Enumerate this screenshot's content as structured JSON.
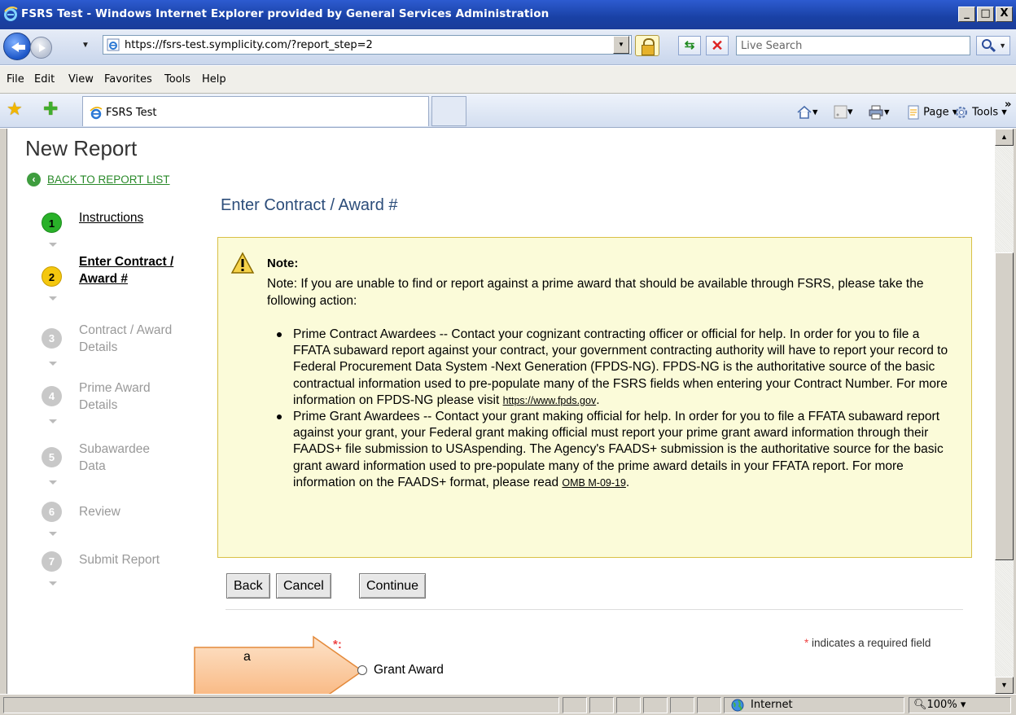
{
  "window": {
    "title": "FSRS Test - Windows Internet Explorer provided by General Services Administration",
    "buttons": [
      "_",
      "□",
      "X"
    ]
  },
  "address": {
    "url": "https://fsrs-test.symplicity.com/?report_step=2",
    "search_placeholder": "Live Search"
  },
  "menu": [
    "File",
    "Edit",
    "View",
    "Favorites",
    "Tools",
    "Help"
  ],
  "tab": {
    "label": "FSRS Test"
  },
  "toolbar": {
    "page": "Page ▾",
    "tools": "Tools ▾",
    "more": "»"
  },
  "page": {
    "title": "New Report",
    "back_link": "BACK TO REPORT LIST",
    "section_title": "Enter Contract / Award #",
    "steps": [
      {
        "num": "1",
        "label": "Instructions",
        "state": "done"
      },
      {
        "num": "2",
        "label": "Enter Contract / Award #",
        "state": "cur"
      },
      {
        "num": "3",
        "label": "Contract / Award Details",
        "state": "todo"
      },
      {
        "num": "4",
        "label": "Prime Award Details",
        "state": "todo"
      },
      {
        "num": "5",
        "label": "Subawardee Data",
        "state": "todo"
      },
      {
        "num": "6",
        "label": "Review",
        "state": "todo"
      },
      {
        "num": "7",
        "label": "Submit Report",
        "state": "todo"
      }
    ],
    "note": {
      "title": "Note:",
      "intro": "Note: If you are unable to find or report against a prime award that should be available through FSRS, please take the following action:",
      "item1_text": "Prime Contract Awardees -- Contact your cognizant contracting officer or official for help. In order for you to file a FFATA subaward report against your contract, your government contracting authority will have to report your record to Federal Procurement Data System -Next Generation (FPDS-NG). FPDS-NG is the authoritative source of the basic contractual information used to pre-populate many of the FSRS fields when entering your Contract Number. For more information on FPDS-NG please visit ",
      "item1_link": "https://www.fpds.gov",
      "item2_text": "Prime Grant Awardees -- Contact your grant making official for help. In order for you to file a FFATA subaward report against your grant, your Federal grant making official must report your prime grant award information through their FAADS+ file submission to USAspending. The Agency's FAADS+ submission is the authoritative source for the basic grant award information used to pre-populate many of the prime award details in your FFATA report. For more information on the FAADS+ format, please read ",
      "item2_link": "OMB M-09-19",
      "period": "."
    },
    "buttons": {
      "back": "Back",
      "cancel": "Cancel",
      "continue": "Continue"
    },
    "required_note": "indicates a required field",
    "required_marker": "*",
    "asterisk_label": "*:",
    "radio_grant": "Grant Award",
    "callout_label": "a"
  },
  "status": {
    "zone": "Internet",
    "zoom": "100%"
  }
}
